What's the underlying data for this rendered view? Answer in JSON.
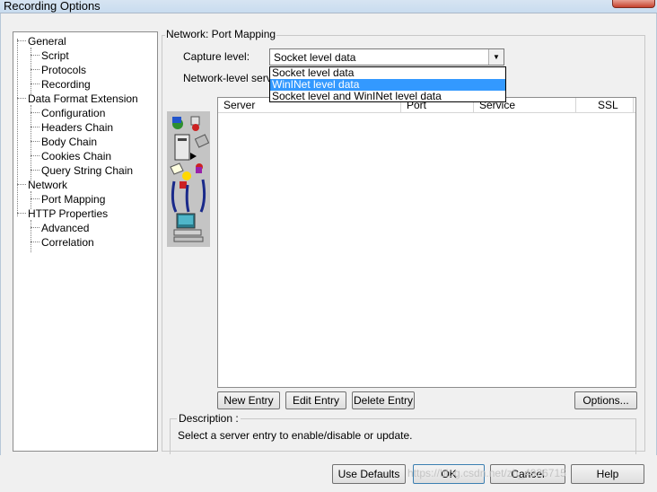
{
  "window": {
    "title": "Recording Options"
  },
  "tree": {
    "items": [
      {
        "label": "General",
        "level": 0
      },
      {
        "label": "Script",
        "level": 1
      },
      {
        "label": "Protocols",
        "level": 1
      },
      {
        "label": "Recording",
        "level": 1
      },
      {
        "label": "Data Format Extension",
        "level": 0
      },
      {
        "label": "Configuration",
        "level": 1
      },
      {
        "label": "Headers Chain",
        "level": 1
      },
      {
        "label": "Body Chain",
        "level": 1
      },
      {
        "label": "Cookies Chain",
        "level": 1
      },
      {
        "label": "Query String Chain",
        "level": 1
      },
      {
        "label": "Network",
        "level": 0
      },
      {
        "label": "Port Mapping",
        "level": 1
      },
      {
        "label": "HTTP Properties",
        "level": 0
      },
      {
        "label": "Advanced",
        "level": 1
      },
      {
        "label": "Correlation",
        "level": 1
      }
    ]
  },
  "panel": {
    "group_title": "Network: Port Mapping",
    "capture_label": "Capture level:",
    "capture_value": "Socket level data",
    "capture_options": [
      "Socket level data",
      "WinINet level data",
      "Socket level and WinINet level data"
    ],
    "capture_selected_index": 1,
    "netlevel_label": "Network-level server",
    "columns": [
      "Server",
      "Port",
      "Service",
      "SSL"
    ]
  },
  "buttons": {
    "new_entry": "New Entry",
    "edit_entry": "Edit Entry",
    "delete_entry": "Delete Entry",
    "options": "Options...",
    "use_defaults": "Use Defaults",
    "ok": "OK",
    "cancel": "Cancel",
    "help": "Help"
  },
  "description": {
    "title": "Description :",
    "text": "Select a server entry to enable/disable or update."
  },
  "watermark": "https://blog.csdn.net/zh_4926715"
}
